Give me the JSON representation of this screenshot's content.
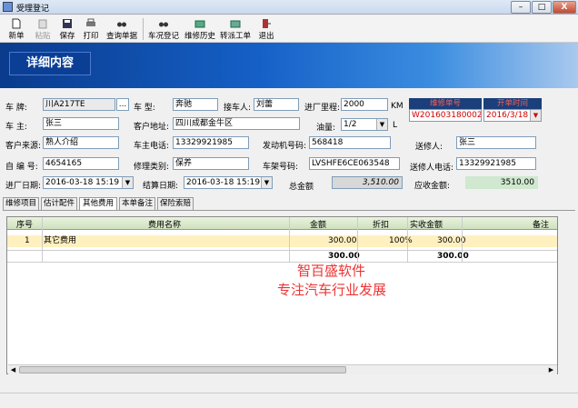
{
  "window": {
    "title": "受理登记",
    "minimize": "–",
    "maximize": "□",
    "close": "X"
  },
  "toolbar": [
    {
      "label": "新单",
      "disabled": false
    },
    {
      "label": "粘贴",
      "disabled": true
    },
    {
      "label": "保存",
      "disabled": false
    },
    {
      "label": "打印",
      "disabled": false
    },
    {
      "label": "查询单据",
      "disabled": false
    },
    {
      "label": "车况登记",
      "disabled": false
    },
    {
      "label": "维修历史",
      "disabled": false
    },
    {
      "label": "转派工单",
      "disabled": false
    },
    {
      "label": "退出",
      "disabled": false
    }
  ],
  "banner": {
    "title": "详细内容"
  },
  "form": {
    "plate_label": "车    牌:",
    "plate": "川A217TE",
    "plate_btn": "...",
    "model_label": "车    型:",
    "model": "奔驰",
    "receiver_label": "接车人:",
    "receiver": "刘蕾",
    "mileage_label": "进厂里程:",
    "mileage": "2000",
    "mileage_unit": "KM",
    "repair_no_label": "维修单号",
    "repair_no": "W201603180002",
    "settle_time_label": "开单时间",
    "settle_time": "2016/3/18",
    "owner_label": "车    主:",
    "owner": "张三",
    "address_label": "客户地址:",
    "address": "四川成都金牛区",
    "fuel_label": "油量:",
    "fuel": "1/2",
    "fuel_unit": "L",
    "source_label": "客户来源:",
    "source": "熟人介绍",
    "phone_label": "车主电话:",
    "phone": "13329921985",
    "engine_label": "发动机号码:",
    "engine": "568418",
    "sender_label": "送修人:",
    "sender": "张三",
    "self_no_label": "自 编 号:",
    "self_no": "4654165",
    "repair_type_label": "修理类别:",
    "repair_type": "保养",
    "frame_label": "车架号码:",
    "frame": "LVSHFE6CE063548",
    "sender_phone_label": "送修人电话:",
    "sender_phone": "13329921985",
    "in_date_label": "进厂日期:",
    "in_date": "2016-03-18 15:19",
    "settle_date_label": "结算日期:",
    "settle_date": "2016-03-18 15:19",
    "total_label": "总金额",
    "total": "3,510.00",
    "receivable_label": "应收金额:",
    "receivable": "3510.00"
  },
  "tabs": [
    "维修项目",
    "估计配件",
    "其他费用",
    "本单备注",
    "保险索赔"
  ],
  "grid": {
    "headers": [
      "序号",
      "费用名称",
      "金额",
      "折扣",
      "实收金额",
      "备注"
    ],
    "rows": [
      {
        "no": "1",
        "name": "其它费用",
        "amount": "300.00",
        "discount": "100%",
        "actual": "300.00",
        "note": ""
      }
    ],
    "totals": {
      "amount": "300.00",
      "actual": "300.00"
    }
  },
  "watermark": {
    "line1": "智百盛软件",
    "line2": "专注汽车行业发展"
  }
}
